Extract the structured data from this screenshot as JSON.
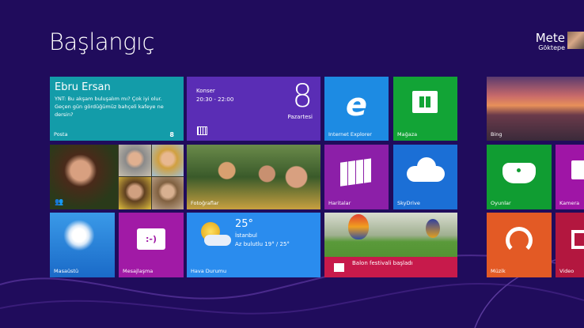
{
  "header": {
    "title": "Başlangıç",
    "user_first": "Mete",
    "user_last": "Göktepe"
  },
  "tiles": {
    "mail": {
      "sender": "Ebru Ersan",
      "message": "YNT: Bu akşam buluşalım mı? Çok iyi olur. Geçen gün gördüğümüz bahçeli kafeye ne dersin?",
      "label": "Posta",
      "count": "8",
      "color": "#139ca9"
    },
    "calendar": {
      "event": "Konser",
      "time": "20:30 - 22:00",
      "day": "8",
      "weekday": "Pazartesi",
      "color": "#5a2db5"
    },
    "ie": {
      "label": "Internet Explorer",
      "color": "#1d8be3"
    },
    "store": {
      "label": "Mağaza",
      "color": "#12a436"
    },
    "bing": {
      "label": "Bing"
    },
    "people": {},
    "photos": {
      "label": "Fotoğraflar"
    },
    "maps": {
      "label": "Haritalar",
      "color": "#8c1fa8"
    },
    "skydrive": {
      "label": "SkyDrive",
      "color": "#1b6fd6"
    },
    "games": {
      "label": "Oyunlar",
      "color": "#109d32"
    },
    "camera": {
      "label": "Kamera",
      "color": "#9f15a6"
    },
    "desktop": {
      "label": "Masaüstü"
    },
    "messaging": {
      "label": "Mesajlaşma",
      "icon_text": ":-)",
      "color": "#a11aa6"
    },
    "weather": {
      "temp": "25°",
      "city": "İstanbul",
      "condition": "Az bulutlu 19° / 25°",
      "label": "Hava Durumu",
      "color": "#2a8cee"
    },
    "news": {
      "headline": "Balon festivali başladı",
      "color": "#c71a4b"
    },
    "music": {
      "label": "Müzik",
      "color": "#e35a25"
    },
    "video": {
      "label": "Video",
      "color": "#b3173f"
    }
  }
}
